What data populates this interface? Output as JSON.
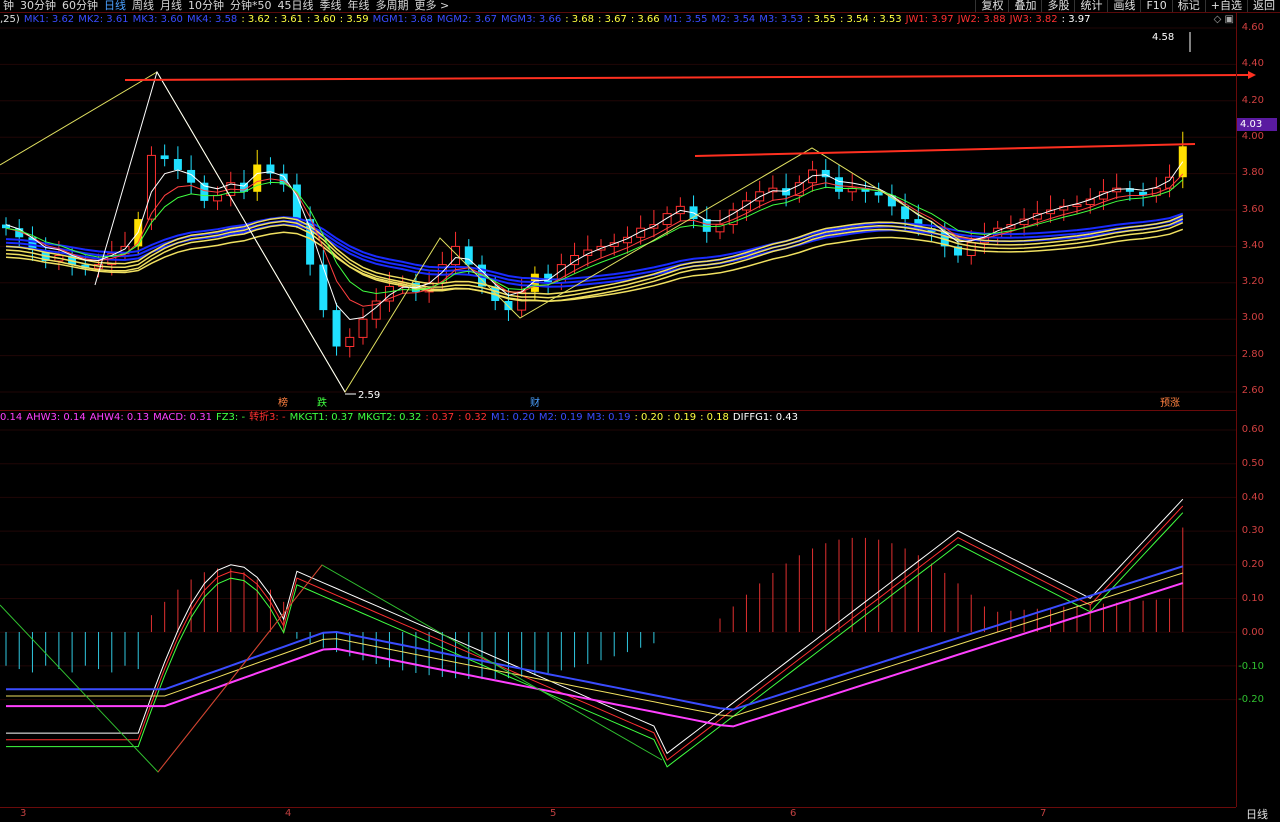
{
  "topbar": {
    "periods": [
      "钟",
      "30分钟",
      "60分钟",
      "日线",
      "周线",
      "月线",
      "10分钟",
      "分钟*50",
      "45日线",
      "季线",
      "年线",
      "多周期",
      "更多 >"
    ],
    "active_period": "日线",
    "tools": [
      "复权",
      "叠加",
      "多股",
      "统计",
      "画线",
      "F10",
      "标记",
      "+自选",
      "返回"
    ]
  },
  "main_legend": {
    "prefix": ",25)",
    "items": [
      {
        "text": "MK1: 3.62",
        "color": "#3a4cff"
      },
      {
        "text": "MK2: 3.61",
        "color": "#3a4cff"
      },
      {
        "text": "MK3: 3.60",
        "color": "#3a4cff"
      },
      {
        "text": "MK4: 3.58",
        "color": "#3a4cff"
      },
      {
        "text": ": 3.62",
        "color": "#ffff40"
      },
      {
        "text": ": 3.61",
        "color": "#ffff40"
      },
      {
        "text": ": 3.60",
        "color": "#ffff40"
      },
      {
        "text": ": 3.59",
        "color": "#ffff40"
      },
      {
        "text": "MGM1: 3.68",
        "color": "#3a4cff"
      },
      {
        "text": "MGM2: 3.67",
        "color": "#3a4cff"
      },
      {
        "text": "MGM3: 3.66",
        "color": "#3a4cff"
      },
      {
        "text": ": 3.68",
        "color": "#ffff40"
      },
      {
        "text": ": 3.67",
        "color": "#ffff40"
      },
      {
        "text": ": 3.66",
        "color": "#ffff40"
      },
      {
        "text": "M1: 3.55",
        "color": "#3a4cff"
      },
      {
        "text": "M2: 3.54",
        "color": "#3a4cff"
      },
      {
        "text": "M3: 3.53",
        "color": "#3a4cff"
      },
      {
        "text": ": 3.55",
        "color": "#ffff40"
      },
      {
        "text": ": 3.54",
        "color": "#ffff40"
      },
      {
        "text": ": 3.53",
        "color": "#ffff40"
      },
      {
        "text": "JW1: 3.97",
        "color": "#ff3030"
      },
      {
        "text": "JW2: 3.88",
        "color": "#ff3030"
      },
      {
        "text": "JW3: 3.82",
        "color": "#ff3030"
      },
      {
        "text": ": 3.97",
        "color": "#ffffff"
      }
    ]
  },
  "sub_legend": {
    "items": [
      {
        "text": "0.14",
        "color": "#ff40ff"
      },
      {
        "text": "AHW3: 0.14",
        "color": "#ff40ff"
      },
      {
        "text": "AHW4: 0.13",
        "color": "#ff40ff"
      },
      {
        "text": "MACD: 0.31",
        "color": "#ff40ff"
      },
      {
        "text": "FZ3: -",
        "color": "#40ff40"
      },
      {
        "text": "转折3: -",
        "color": "#ff3030"
      },
      {
        "text": "MKGT1: 0.37",
        "color": "#40ff40"
      },
      {
        "text": "MKGT2: 0.32",
        "color": "#40ff40"
      },
      {
        "text": ": 0.37",
        "color": "#ff3030"
      },
      {
        "text": ": 0.32",
        "color": "#ff3030"
      },
      {
        "text": "M1: 0.20",
        "color": "#3a4cff"
      },
      {
        "text": "M2: 0.19",
        "color": "#3a4cff"
      },
      {
        "text": "M3: 0.19",
        "color": "#3a4cff"
      },
      {
        "text": ": 0.20",
        "color": "#ffff40"
      },
      {
        "text": ": 0.19",
        "color": "#ffff40"
      },
      {
        "text": ": 0.18",
        "color": "#ffff40"
      },
      {
        "text": "DIFFG1: 0.43",
        "color": "#ffffff"
      }
    ]
  },
  "price_axis": [
    "4.60",
    "4.40",
    "4.20",
    "4.00",
    "3.80",
    "3.60",
    "3.40",
    "3.20",
    "3.00",
    "2.80",
    "2.60"
  ],
  "indicator_axis": [
    "0.60",
    "0.50",
    "0.40",
    "0.30",
    "0.20",
    "0.10",
    "0.00",
    "-0.10",
    "-0.20"
  ],
  "current_price": "4.03",
  "high_label": "4.58",
  "low_label": "2.59",
  "markers": [
    {
      "text": "榜",
      "color": "#ff8040"
    },
    {
      "text": "跌",
      "color": "#40ff40"
    },
    {
      "text": "财",
      "color": "#4aa0ff"
    },
    {
      "text": "预涨",
      "color": "#ff8040"
    }
  ],
  "dates": [
    "3",
    "4",
    "5",
    "6",
    "7"
  ],
  "period_label": "日线",
  "colors": {
    "up": "#ff3030",
    "down": "#20e0ff",
    "highlight": "#ffe000",
    "ma_blue": "#1a2cff",
    "ma_yellow": "#f0e060"
  }
}
